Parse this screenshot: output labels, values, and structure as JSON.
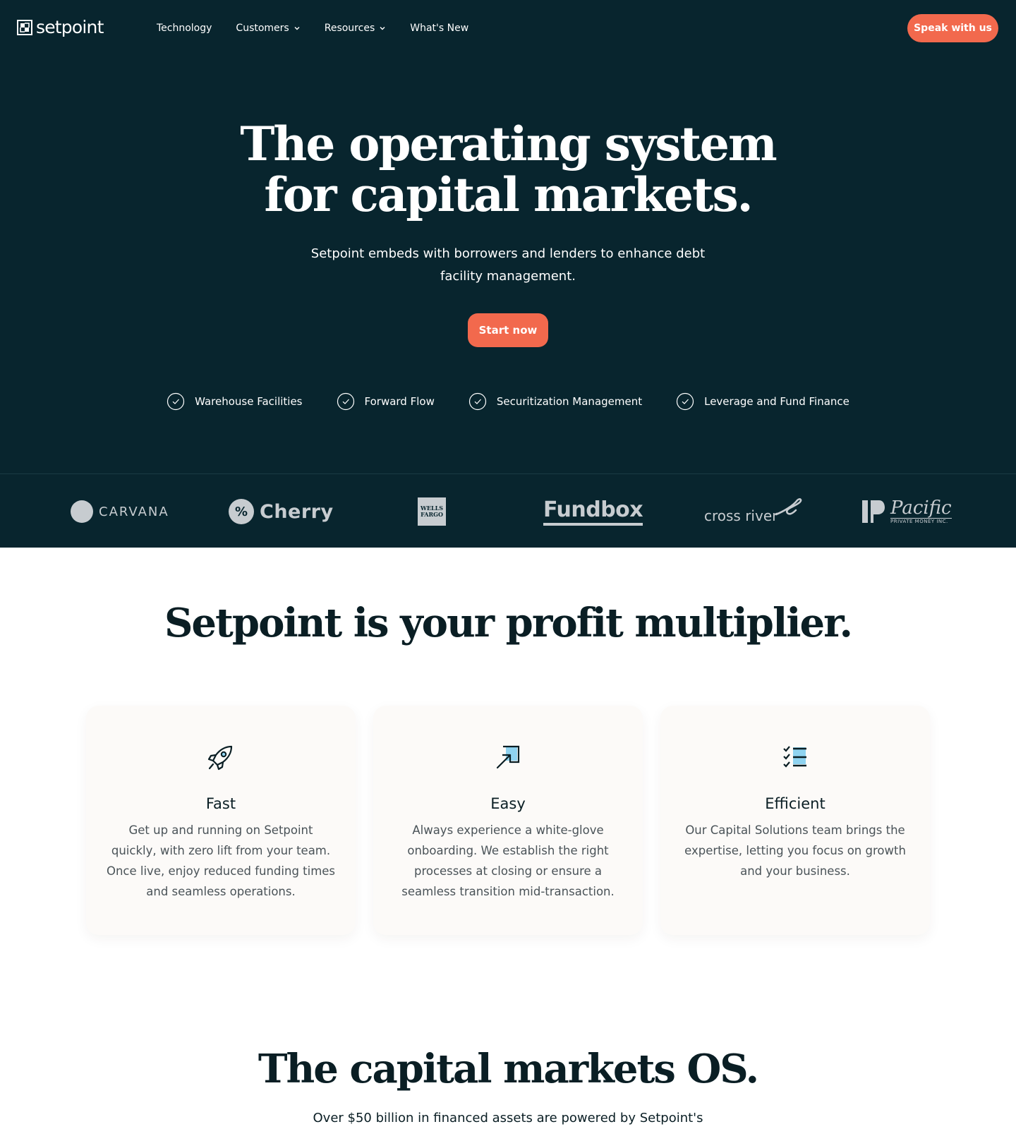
{
  "brand": {
    "name": "setpoint"
  },
  "nav": {
    "links": [
      {
        "label": "Technology",
        "dropdown": false
      },
      {
        "label": "Customers",
        "dropdown": true
      },
      {
        "label": "Resources",
        "dropdown": true
      },
      {
        "label": "What's New",
        "dropdown": false
      }
    ],
    "cta_label": "Speak with us"
  },
  "hero": {
    "title_line1": "The operating system",
    "title_line2": "for capital markets.",
    "subtitle_line1": "Setpoint embeds with borrowers and lenders to enhance debt",
    "subtitle_line2": "facility management.",
    "cta_label": "Start now",
    "features": [
      "Warehouse Facilities",
      "Forward Flow",
      "Securitization Management",
      "Leverage and Fund Finance"
    ]
  },
  "customer_logos": {
    "carvana": "CARVANA",
    "cherry": "Cherry",
    "cherry_mark": "%",
    "wells_fargo_line1": "WELLS",
    "wells_fargo_line2": "FARGO",
    "fundbox": "Fundbox",
    "cross_river": "cross river",
    "pacific": "Pacific",
    "pacific_sub": "PRIVATE MONEY INC."
  },
  "profit": {
    "title": "Setpoint is your profit multiplier.",
    "cards": [
      {
        "icon": "rocket-icon",
        "title": "Fast",
        "body": "Get up and running on Setpoint quickly, with zero lift from your team. Once live, enjoy reduced funding times and seamless operations."
      },
      {
        "icon": "arrow-into-box-icon",
        "title": "Easy",
        "body": "Always experience a white-glove onboarding. We establish the right processes at closing or ensure a seamless transition mid-transaction."
      },
      {
        "icon": "checklist-icon",
        "title": "Efficient",
        "body": "Our Capital Solutions team brings the expertise, letting you focus on growth and your business."
      }
    ]
  },
  "os_section": {
    "title": "The capital markets OS.",
    "subtitle": "Over $50 billion in financed assets are powered by Setpoint's"
  },
  "colors": {
    "hero_bg": "#08252e",
    "accent": "#f2694d",
    "card_bg": "#fcfaf8",
    "icon_blue": "#8fd3f0"
  }
}
